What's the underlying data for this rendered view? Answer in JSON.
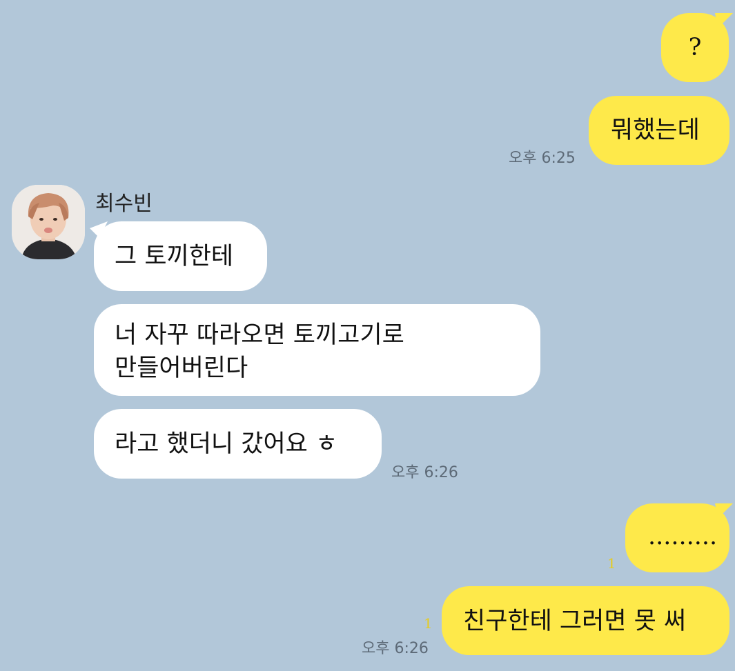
{
  "theme": {
    "background": "#b2c7d9",
    "outgoing_bubble": "#fee94a",
    "incoming_bubble": "#ffffff",
    "unread_color": "#e6cc1f"
  },
  "chat": {
    "messages_out_1": [
      {
        "text": "?"
      },
      {
        "text": "뭐했는데",
        "time": "오후 6:25"
      }
    ],
    "sender": {
      "name": "최수빈",
      "avatar_icon": "profile-photo"
    },
    "messages_in": [
      {
        "text": "그 토끼한테"
      },
      {
        "line1": "너 자꾸 따라오면 토끼고기로",
        "line2": "만들어버린다"
      },
      {
        "text": "라고 했더니 갔어요 ㅎ",
        "time": "오후 6:26"
      }
    ],
    "messages_out_2": [
      {
        "text": ".........",
        "unread": "1"
      },
      {
        "text": "친구한테 그러면 못 써",
        "unread": "1",
        "time": "오후 6:26"
      }
    ]
  }
}
